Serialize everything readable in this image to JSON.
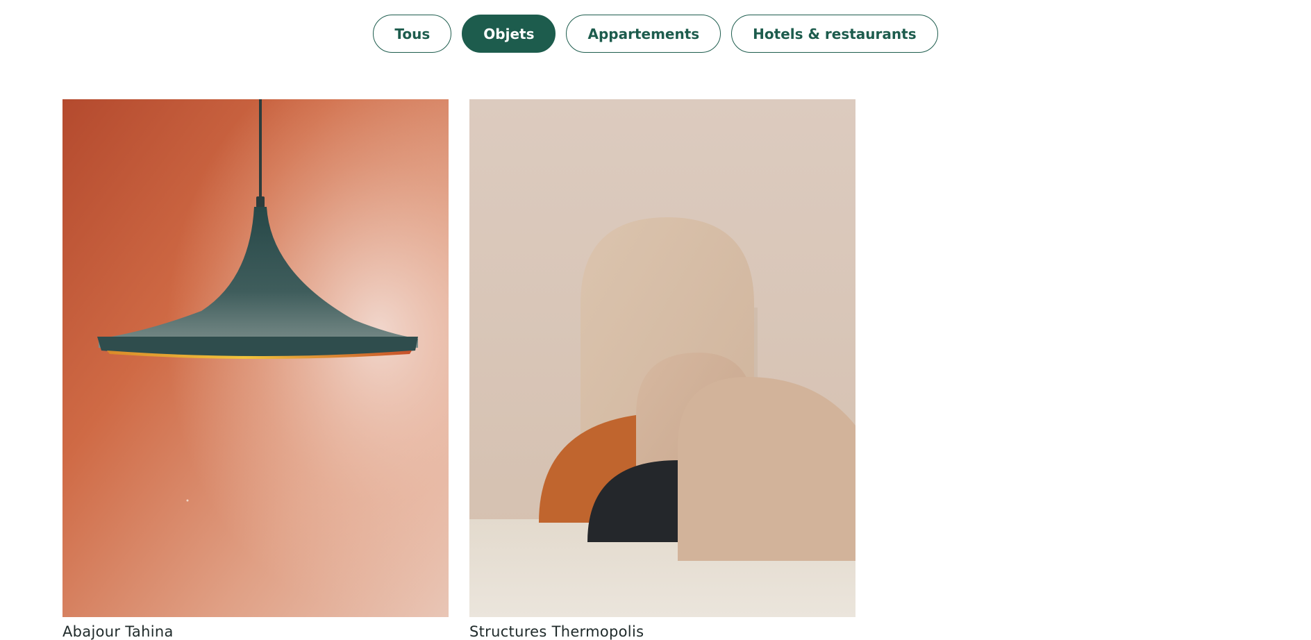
{
  "filters": [
    {
      "label": "Tous",
      "active": false
    },
    {
      "label": "Objets",
      "active": true
    },
    {
      "label": "Appartements",
      "active": false
    },
    {
      "label": "Hotels & restaurants",
      "active": false
    }
  ],
  "projects": [
    {
      "title": "Abajour Tahina",
      "image": "pendant-lamp-on-terracotta-wall"
    },
    {
      "title": "Structures Thermopolis",
      "image": "arched-panel-sculptures"
    }
  ],
  "colors": {
    "accent": "#1d5c4d",
    "text": "#1f2a2a",
    "background": "#ffffff"
  }
}
